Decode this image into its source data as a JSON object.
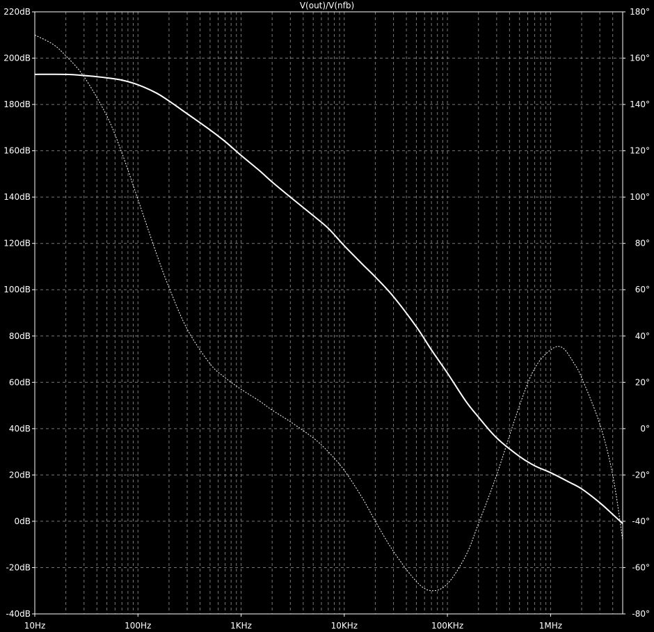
{
  "chart_data": {
    "type": "line",
    "title": "V(out)/V(nfb)",
    "x_scale": "log",
    "x_unit": "Hz",
    "xlim": [
      10,
      5000000
    ],
    "ylim_left": [
      -40,
      220
    ],
    "ylim_right": [
      -80,
      180
    ],
    "grid": true,
    "background": "#000000",
    "colors": {
      "magnitude": "#ffffff",
      "phase": "#ffffff",
      "grid": "#7a7a7a"
    },
    "x_ticks": [
      {
        "value": 10,
        "label": "10Hz"
      },
      {
        "value": 100,
        "label": "100Hz"
      },
      {
        "value": 1000,
        "label": "1KHz"
      },
      {
        "value": 10000,
        "label": "10KHz"
      },
      {
        "value": 100000,
        "label": "100KHz"
      },
      {
        "value": 1000000,
        "label": "1MHz"
      }
    ],
    "y_left_ticks": [
      {
        "value": 220,
        "label": "220dB"
      },
      {
        "value": 200,
        "label": "200dB"
      },
      {
        "value": 180,
        "label": "180dB"
      },
      {
        "value": 160,
        "label": "160dB"
      },
      {
        "value": 140,
        "label": "140dB"
      },
      {
        "value": 120,
        "label": "120dB"
      },
      {
        "value": 100,
        "label": "100dB"
      },
      {
        "value": 80,
        "label": "80dB"
      },
      {
        "value": 60,
        "label": "60dB"
      },
      {
        "value": 40,
        "label": "40dB"
      },
      {
        "value": 20,
        "label": "20dB"
      },
      {
        "value": 0,
        "label": "0dB"
      },
      {
        "value": -20,
        "label": "-20dB"
      },
      {
        "value": -40,
        "label": "-40dB"
      }
    ],
    "y_right_ticks": [
      {
        "value": 180,
        "label": "180°"
      },
      {
        "value": 160,
        "label": "160°"
      },
      {
        "value": 140,
        "label": "140°"
      },
      {
        "value": 120,
        "label": "120°"
      },
      {
        "value": 100,
        "label": "100°"
      },
      {
        "value": 80,
        "label": "80°"
      },
      {
        "value": 60,
        "label": "60°"
      },
      {
        "value": 40,
        "label": "40°"
      },
      {
        "value": 20,
        "label": "20°"
      },
      {
        "value": 0,
        "label": "0°"
      },
      {
        "value": -20,
        "label": "-20°"
      },
      {
        "value": -40,
        "label": "-40°"
      },
      {
        "value": -60,
        "label": "-60°"
      },
      {
        "value": -80,
        "label": "-80°"
      }
    ],
    "series": [
      {
        "axis": "left",
        "style": "solid",
        "x": [
          10,
          20,
          30,
          50,
          70,
          100,
          150,
          200,
          300,
          500,
          700,
          1000,
          1500,
          2000,
          3000,
          5000,
          7000,
          10000,
          15000,
          20000,
          30000,
          50000,
          70000,
          100000,
          150000,
          200000,
          300000,
          500000,
          700000,
          1000000,
          1500000,
          2000000,
          3000000,
          4000000,
          5000000
        ],
        "values": [
          193,
          193,
          192.5,
          191.5,
          190.5,
          188.5,
          185,
          181.5,
          176,
          169,
          164,
          158,
          151.5,
          146.5,
          140,
          132,
          126.5,
          119,
          111,
          105.5,
          97,
          84,
          74,
          64,
          52,
          45,
          36,
          28,
          24,
          21,
          17,
          14,
          8,
          3,
          -1
        ]
      },
      {
        "axis": "right",
        "style": "dotted",
        "x": [
          10,
          15,
          20,
          30,
          50,
          70,
          100,
          150,
          200,
          300,
          500,
          700,
          1000,
          1500,
          2000,
          3000,
          5000,
          7000,
          10000,
          15000,
          20000,
          30000,
          50000,
          70000,
          100000,
          150000,
          200000,
          300000,
          500000,
          700000,
          1000000,
          1300000,
          1700000,
          2000000,
          3000000,
          4000000,
          5000000
        ],
        "values": [
          170,
          166,
          161,
          152,
          135,
          119,
          99,
          76,
          61,
          43,
          28,
          22,
          17,
          12,
          8,
          3,
          -4,
          -10,
          -18,
          -30,
          -40,
          -53,
          -66,
          -70,
          -67,
          -55,
          -41,
          -20,
          10,
          26,
          34,
          35,
          28,
          22,
          2,
          -20,
          -48
        ]
      }
    ]
  }
}
